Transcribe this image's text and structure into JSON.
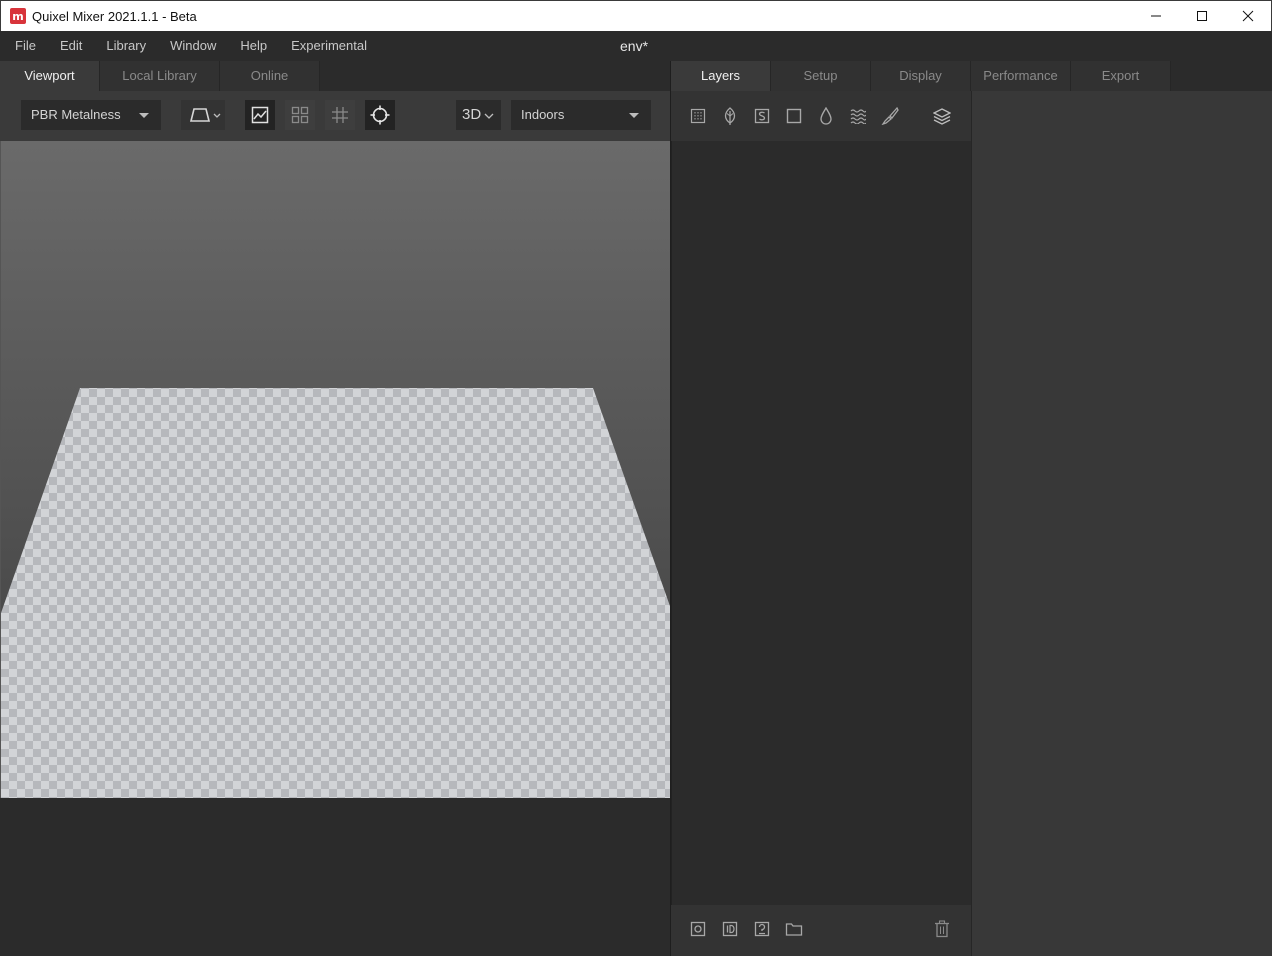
{
  "window": {
    "title": "Quixel Mixer 2021.1.1 - Beta",
    "logo_letter": "m",
    "controls": [
      "minimize-icon",
      "maximize-icon",
      "close-icon"
    ]
  },
  "menubar": {
    "items": [
      "File",
      "Edit",
      "Library",
      "Window",
      "Help",
      "Experimental"
    ],
    "document_title": "env*"
  },
  "left_tabs": [
    {
      "label": "Viewport",
      "active": true
    },
    {
      "label": "Local Library",
      "active": false
    },
    {
      "label": "Online",
      "active": false
    }
  ],
  "viewport_toolbar": {
    "material_mode": "PBR Metalness",
    "view_mode": "3D",
    "environment": "Indoors",
    "icons": [
      "projection-icon",
      "image-icon",
      "grid-view-icon",
      "grid-overlay-icon",
      "focus-target-icon"
    ]
  },
  "right_tabs": [
    {
      "label": "Layers",
      "active": true
    },
    {
      "label": "Setup",
      "active": false
    },
    {
      "label": "Display",
      "active": false
    },
    {
      "label": "Performance",
      "active": false
    },
    {
      "label": "Export",
      "active": false
    }
  ],
  "layer_tools": [
    "surface-layer-icon",
    "leaf-layer-icon",
    "smart-material-icon",
    "solid-layer-icon",
    "water-drop-icon",
    "fluid-layer-icon",
    "brush-icon",
    "layer-stack-icon"
  ],
  "layer_footer_tools": [
    "add-mask-icon",
    "id-mask-icon",
    "unknown-map-icon",
    "folder-icon",
    "trash-icon"
  ],
  "colors": {
    "background": "#2b2b2b",
    "panel": "#3a3a3a",
    "logo_red": "#d8343b",
    "checker_light": "#d2d4d7",
    "checker_dark": "#b6b8bc"
  }
}
